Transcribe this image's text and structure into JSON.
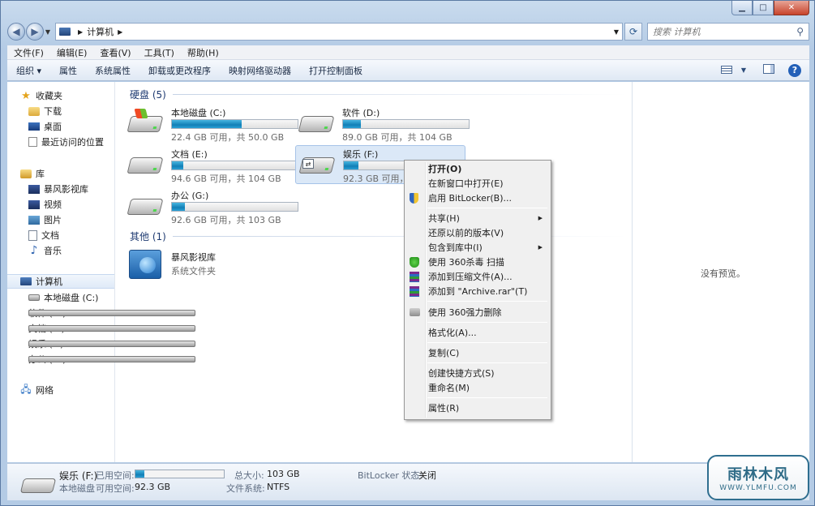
{
  "window": {
    "caption": {
      "minimize": "▁",
      "maximize": "□",
      "close": "✕"
    }
  },
  "address": {
    "back": "◀",
    "forward": "▶",
    "path": [
      "计算机"
    ],
    "search_placeholder": "搜索 计算机"
  },
  "menubar": [
    "文件(F)",
    "编辑(E)",
    "查看(V)",
    "工具(T)",
    "帮助(H)"
  ],
  "toolbar": {
    "commands": [
      "组织 ▾",
      "属性",
      "系统属性",
      "卸载或更改程序",
      "映射网络驱动器",
      "打开控制面板"
    ]
  },
  "nav": {
    "favorites": {
      "label": "收藏夹",
      "items": [
        "下载",
        "桌面",
        "最近访问的位置"
      ]
    },
    "libraries": {
      "label": "库",
      "items": [
        "暴风影视库",
        "视频",
        "图片",
        "文档",
        "音乐"
      ]
    },
    "computer": {
      "label": "计算机",
      "items": [
        "本地磁盘 (C:)",
        "软件 (D:)",
        "文档 (E:)",
        "娱乐 (F:)",
        "办公 (G:)"
      ]
    },
    "network": {
      "label": "网络"
    }
  },
  "groups": {
    "disks_title": "硬盘 (5)",
    "other_title": "其他 (1)"
  },
  "drives": [
    {
      "name": "本地磁盘 (C:)",
      "info": "22.4 GB 可用，共 50.0 GB",
      "used_fraction": 0.552
    },
    {
      "name": "软件 (D:)",
      "info": "89.0 GB 可用，共 104 GB",
      "used_fraction": 0.144
    },
    {
      "name": "文档 (E:)",
      "info": "94.6 GB 可用，共 104 GB",
      "used_fraction": 0.09
    },
    {
      "name": "娱乐 (F:)",
      "info": "92.3 GB 可用，共",
      "used_fraction": 0.113
    },
    {
      "name": "办公 (G:)",
      "info": "92.6 GB 可用，共 103 GB",
      "used_fraction": 0.101
    }
  ],
  "other": [
    {
      "name": "暴风影视库",
      "subtitle": "系统文件夹"
    }
  ],
  "preview_text": "没有预览。",
  "context_menu": [
    {
      "label": "打开(O)",
      "bold": true
    },
    {
      "label": "在新窗口中打开(E)"
    },
    {
      "label": "启用 BitLocker(B)...",
      "icon": "shield-icon"
    },
    {
      "label": "共享(H)",
      "submenu": true
    },
    {
      "label": "还原以前的版本(V)"
    },
    {
      "label": "包含到库中(I)",
      "submenu": true
    },
    {
      "label": "使用 360杀毒 扫描",
      "icon": "antivirus-360-icon"
    },
    {
      "label": "添加到压缩文件(A)...",
      "icon": "winrar-icon"
    },
    {
      "label": "添加到 \"Archive.rar\"(T)",
      "icon": "winrar-icon"
    },
    {
      "label": "使用 360强力删除",
      "icon": "shredder-icon"
    },
    {
      "label": "格式化(A)..."
    },
    {
      "label": "复制(C)"
    },
    {
      "label": "创建快捷方式(S)"
    },
    {
      "label": "重命名(M)"
    },
    {
      "label": "属性(R)"
    }
  ],
  "details": {
    "name": "娱乐 (F:)",
    "used_label": "已用空间:",
    "type": "本地磁盘",
    "free_label": "可用空间:",
    "free_value": "92.3 GB",
    "total_label": "总大小:",
    "total_value": "103 GB",
    "fs_label": "文件系统:",
    "fs_value": "NTFS",
    "bitlocker_label": "BitLocker 状态:",
    "bitlocker_value": "关闭",
    "used_fraction": 0.104
  },
  "watermark": {
    "line1": "雨林木风",
    "line2": "WWW.YLMFU.COM"
  },
  "colors": {
    "accent": "#1e3a71",
    "bar_fill": "#127fb6"
  }
}
